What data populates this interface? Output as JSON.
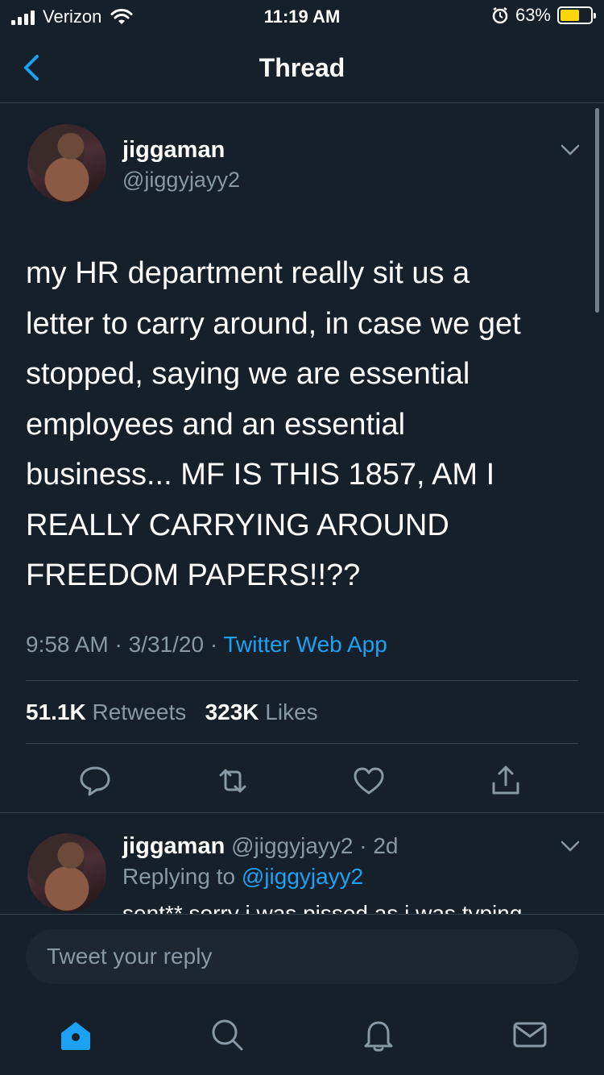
{
  "status_bar": {
    "carrier": "Verizon",
    "time": "11:19 AM",
    "battery_percent": "63%",
    "battery_level": 0.63,
    "icons": [
      "signal-icon",
      "wifi-icon",
      "alarm-icon",
      "battery-icon"
    ]
  },
  "nav": {
    "title": "Thread",
    "back_icon": "chevron-left-icon"
  },
  "tweet": {
    "display_name": "jiggaman",
    "handle": "@jiggyjayy2",
    "text": "my HR department really sit us a\nletter to carry around, in case we get\nstopped, saying we are essential\nemployees and an essential\nbusiness... MF IS THIS 1857, AM I\nREALLY CARRYING AROUND\nFREEDOM PAPERS!!??",
    "time": "9:58 AM",
    "date": "3/31/20",
    "source": "Twitter Web App",
    "retweets_count": "51.1K",
    "retweets_label": "Retweets",
    "likes_count": "323K",
    "likes_label": "Likes",
    "actions": [
      "reply-icon",
      "retweet-icon",
      "like-icon",
      "share-icon"
    ]
  },
  "reply": {
    "display_name": "jiggaman",
    "handle": "@jiggyjayy2",
    "age": "2d",
    "replying_prefix": "Replying to",
    "replying_to": "@jiggyjayy2",
    "text_partial": "sent** sorry i was pissed as i was typing"
  },
  "composer": {
    "placeholder": "Tweet your reply"
  },
  "tab_bar": {
    "tabs": [
      "home-icon",
      "search-icon",
      "notifications-icon",
      "messages-icon"
    ]
  },
  "colors": {
    "background": "#15202b",
    "accent": "#1da1f2",
    "secondary_text": "#8899a6",
    "divider": "#38444d"
  }
}
